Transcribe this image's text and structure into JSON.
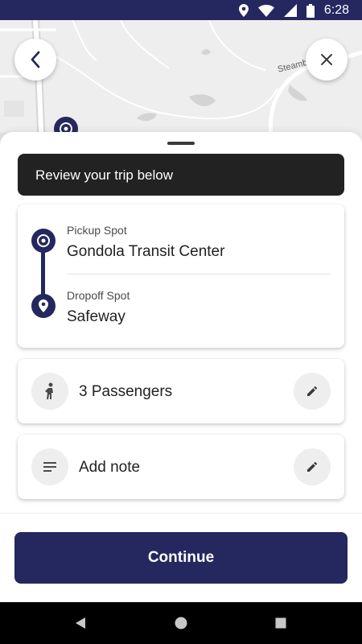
{
  "status_bar": {
    "time": "6:28",
    "icons": [
      "location-icon",
      "wifi-icon",
      "signal-icon",
      "battery-icon"
    ],
    "background": "#24285e"
  },
  "map": {
    "street_label": "Steambo"
  },
  "header": {
    "back_icon": "chevron-left-icon",
    "close_icon": "close-icon"
  },
  "trip": {
    "banner": "Review your trip below",
    "pickup": {
      "label": "Pickup Spot",
      "name": "Gondola Transit Center"
    },
    "dropoff": {
      "label": "Dropoff Spot",
      "name": "Safeway"
    }
  },
  "passengers": {
    "text": "3 Passengers",
    "icon": "person-icon",
    "edit_icon": "pencil-icon"
  },
  "note": {
    "text": "Add note",
    "icon": "notes-icon",
    "edit_icon": "pencil-icon"
  },
  "actions": {
    "continue_label": "Continue"
  },
  "colors": {
    "primary": "#24285e",
    "banner": "#222222",
    "chip": "#eeeeee"
  }
}
